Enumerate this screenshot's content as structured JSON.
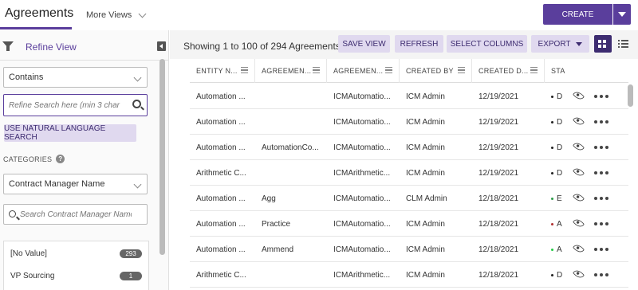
{
  "header": {
    "title": "Agreements",
    "more_views": "More Views",
    "create": "CREATE",
    "accent": "#5a3e9c"
  },
  "left": {
    "refine_label": "Refine View",
    "operator": "Contains",
    "search_placeholder": "Refine Search here (min 3 char",
    "nls_button": "USE NATURAL LANGUAGE SEARCH",
    "categories_label": "CATEGORIES",
    "category_select": "Contract Manager Name",
    "cm_search_placeholder": "Search Contract Manager Name",
    "facets": [
      {
        "label": "[No Value]",
        "count": "293"
      },
      {
        "label": "VP Sourcing",
        "count": "1"
      }
    ]
  },
  "toolbar": {
    "showing": "Showing 1 to 100 of 294 Agreements",
    "save_view": "SAVE VIEW",
    "refresh": "REFRESH",
    "select_columns": "SELECT COLUMNS",
    "export": "EXPORT"
  },
  "table": {
    "columns": [
      "ENTITY N...",
      "AGREEMEN...",
      "AGREEMEN...",
      "CREATED BY",
      "CREATED D...",
      "STA"
    ],
    "rows": [
      {
        "entity": "Automation ...",
        "agr1": "",
        "agr2": "ICMAutomatio...",
        "created_by": "ICM Admin",
        "created_date": "12/19/2021",
        "status": "D",
        "status_color": "#222222"
      },
      {
        "entity": "Automation ...",
        "agr1": "",
        "agr2": "ICMAutomatio...",
        "created_by": "ICM Admin",
        "created_date": "12/19/2021",
        "status": "D",
        "status_color": "#222222"
      },
      {
        "entity": "Automation ...",
        "agr1": "AutomationCo...",
        "agr2": "ICMAutomatio...",
        "created_by": "ICM Admin",
        "created_date": "12/19/2021",
        "status": "D",
        "status_color": "#222222"
      },
      {
        "entity": "Arithmetic C...",
        "agr1": "",
        "agr2": "ICMArithmetic...",
        "created_by": "ICM Admin",
        "created_date": "12/19/2021",
        "status": "D",
        "status_color": "#222222"
      },
      {
        "entity": "Automation ...",
        "agr1": "Agg",
        "agr2": "ICMAutomatio...",
        "created_by": "CLM Admin",
        "created_date": "12/18/2021",
        "status": "E",
        "status_color": "#2e9e4a"
      },
      {
        "entity": "Automation ...",
        "agr1": "Practice",
        "agr2": "ICMAutomatio...",
        "created_by": "ICM Admin",
        "created_date": "12/18/2021",
        "status": "A",
        "status_color": "#b03030"
      },
      {
        "entity": "Automation ...",
        "agr1": "Ammend",
        "agr2": "ICMAutomatio...",
        "created_by": "ICM Admin",
        "created_date": "12/18/2021",
        "status": "A",
        "status_color": "#22cc44"
      },
      {
        "entity": "Arithmetic C...",
        "agr1": "",
        "agr2": "ICMArithmetic...",
        "created_by": "ICM Admin",
        "created_date": "12/18/2021",
        "status": "D",
        "status_color": "#222222"
      }
    ]
  }
}
